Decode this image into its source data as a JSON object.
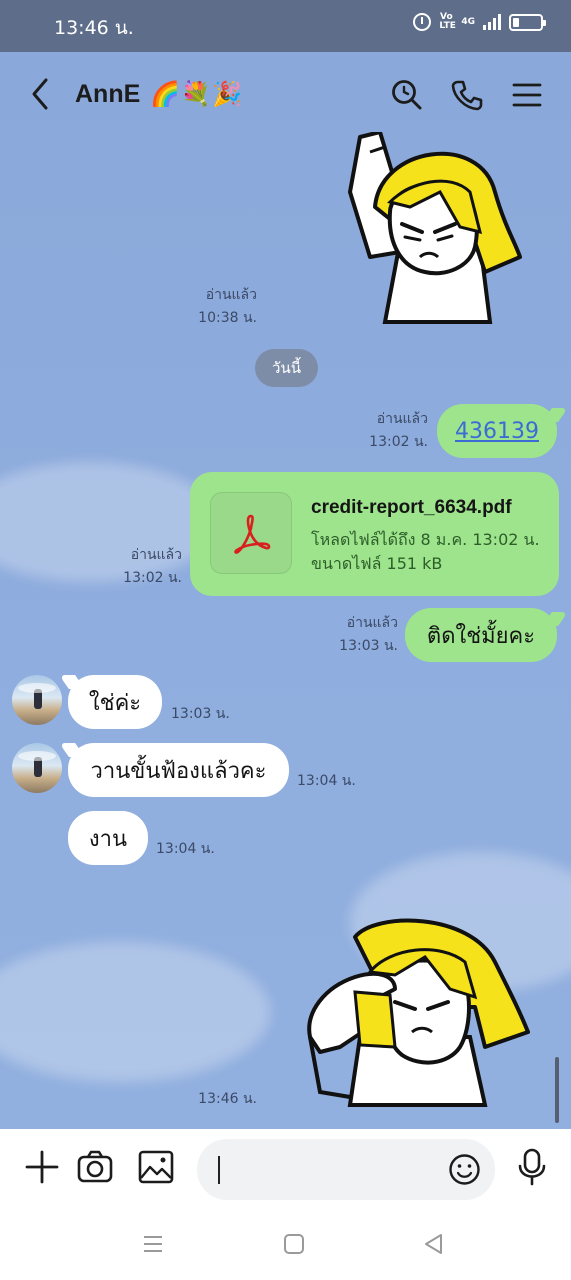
{
  "status_bar": {
    "time": "13:46 น.",
    "network": "4G",
    "volte": "Vo LTE"
  },
  "header": {
    "contact_name": "AnnE",
    "contact_emojis": "🌈💐🎉",
    "icons": [
      "back-icon",
      "search-icon",
      "phone-icon",
      "menu-icon"
    ]
  },
  "messages": {
    "sticker_1": {
      "read_label": "อ่านแล้ว",
      "time": "10:38 น."
    },
    "date_divider": "วันนี้",
    "msg_link": {
      "read_label": "อ่านแล้ว",
      "time": "13:02 น.",
      "text": "436139"
    },
    "msg_file": {
      "read_label": "อ่านแล้ว",
      "time": "13:02 น.",
      "file_name": "credit-report_6634.pdf",
      "download_info": "โหลดไฟล์ได้ถึง 8 ม.ค. 13:02 น.",
      "size_info": "ขนาดไฟล์ 151 kB",
      "icon": "pdf-icon"
    },
    "msg_sent_3": {
      "read_label": "อ่านแล้ว",
      "time": "13:03 น.",
      "text": "ติดใช่มั้ยคะ"
    },
    "msg_recv_1": {
      "text": "ใช่ค่ะ",
      "time": "13:03 น."
    },
    "msg_recv_2": {
      "text": "วานขั้นฟ้องแล้วคะ",
      "time": "13:04 น."
    },
    "msg_recv_3": {
      "text": "งาน",
      "time": "13:04 น."
    },
    "sticker_2": {
      "time": "13:46 น."
    }
  },
  "input_bar": {
    "placeholder": "",
    "icons": [
      "plus-icon",
      "camera-icon",
      "image-icon",
      "emoji-icon",
      "mic-icon"
    ]
  },
  "nav_bar": {
    "icons": [
      "recent-apps-icon",
      "home-icon",
      "back-nav-icon"
    ]
  },
  "colors": {
    "status_bar": "#5d6d8a",
    "chat_background": "#8aa8d9",
    "sent_bubble": "#9de48c",
    "received_bubble": "#ffffff",
    "link": "#3c6bd6",
    "date_chip": "#7d8da8"
  }
}
